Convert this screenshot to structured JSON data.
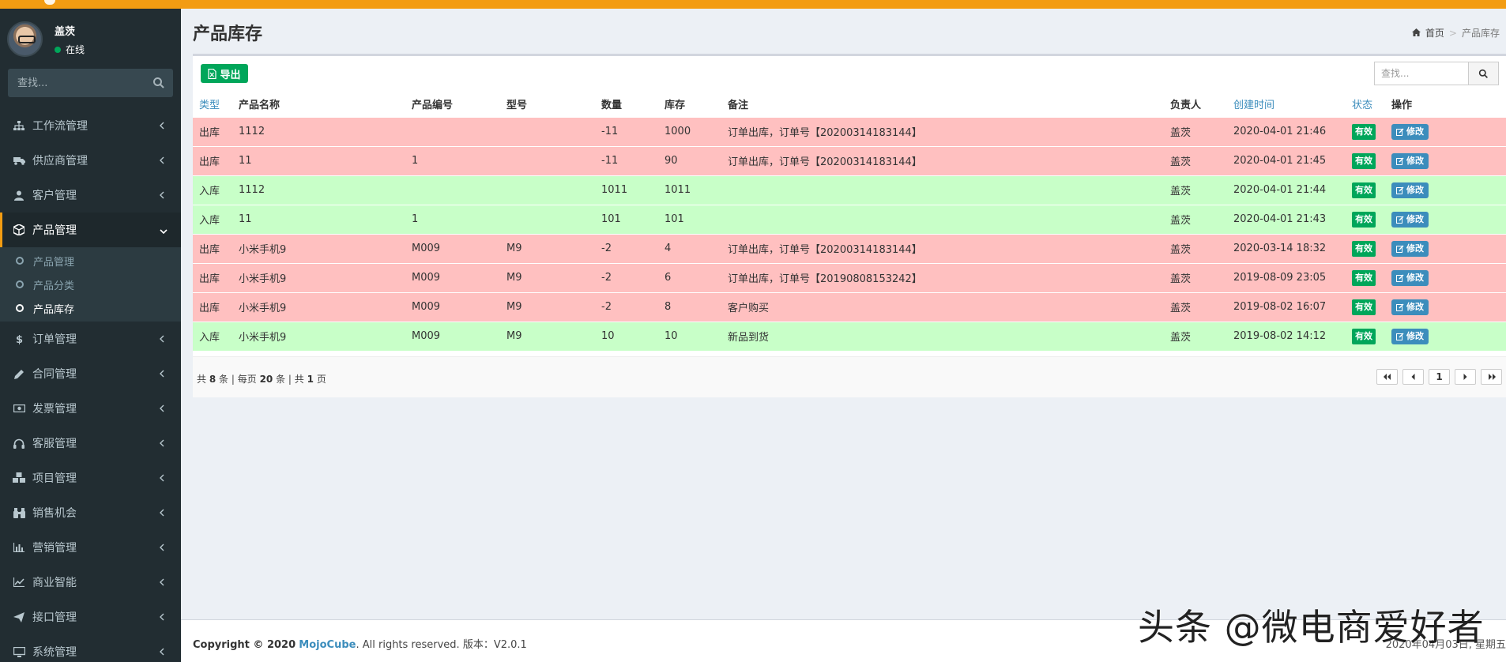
{
  "user": {
    "name": "盖茨",
    "status": "在线"
  },
  "sidebar": {
    "search_placeholder": "查找...",
    "menu": [
      {
        "label": "工作流管理",
        "icon": "sitemap-icon"
      },
      {
        "label": "供应商管理",
        "icon": "truck-icon"
      },
      {
        "label": "客户管理",
        "icon": "user-icon"
      },
      {
        "label": "产品管理",
        "icon": "cube-icon",
        "active": true
      },
      {
        "label": "订单管理",
        "icon": "dollar-icon"
      },
      {
        "label": "合同管理",
        "icon": "pencil-icon"
      },
      {
        "label": "发票管理",
        "icon": "money-icon"
      },
      {
        "label": "客服管理",
        "icon": "headphones-icon"
      },
      {
        "label": "项目管理",
        "icon": "cubes-icon"
      },
      {
        "label": "销售机会",
        "icon": "binoculars-icon"
      },
      {
        "label": "营销管理",
        "icon": "bar-chart-icon"
      },
      {
        "label": "商业智能",
        "icon": "line-chart-icon"
      },
      {
        "label": "接口管理",
        "icon": "paper-plane-icon"
      },
      {
        "label": "系统管理",
        "icon": "desktop-icon"
      }
    ],
    "submenu": [
      "产品管理",
      "产品分类",
      "产品库存"
    ]
  },
  "page": {
    "title": "产品库存",
    "breadcrumb": [
      "首页",
      "产品库存"
    ]
  },
  "toolbar": {
    "export_label": "导出",
    "search_placeholder": "查找..."
  },
  "table": {
    "headers": [
      "类型",
      "产品名称",
      "产品编号",
      "型号",
      "数量",
      "库存",
      "备注",
      "负责人",
      "创建时间",
      "状态",
      "操作"
    ],
    "rows": [
      {
        "kind": "out",
        "cells": [
          "出库",
          "1112",
          "",
          "",
          "-11",
          "1000",
          "订单出库，订单号【20200314183144】",
          "盖茨",
          "2020-04-01 21:46"
        ]
      },
      {
        "kind": "out",
        "cells": [
          "出库",
          "11",
          "1",
          "",
          "-11",
          "90",
          "订单出库，订单号【20200314183144】",
          "盖茨",
          "2020-04-01 21:45"
        ]
      },
      {
        "kind": "in",
        "cells": [
          "入库",
          "1112",
          "",
          "",
          "1011",
          "1011",
          "",
          "盖茨",
          "2020-04-01 21:44"
        ]
      },
      {
        "kind": "in",
        "cells": [
          "入库",
          "11",
          "1",
          "",
          "101",
          "101",
          "",
          "盖茨",
          "2020-04-01 21:43"
        ]
      },
      {
        "kind": "out",
        "cells": [
          "出库",
          "小米手机9",
          "M009",
          "M9",
          "-2",
          "4",
          "订单出库，订单号【20200314183144】",
          "盖茨",
          "2020-03-14 18:32"
        ]
      },
      {
        "kind": "out",
        "cells": [
          "出库",
          "小米手机9",
          "M009",
          "M9",
          "-2",
          "6",
          "订单出库，订单号【20190808153242】",
          "盖茨",
          "2019-08-09 23:05"
        ]
      },
      {
        "kind": "out",
        "cells": [
          "出库",
          "小米手机9",
          "M009",
          "M9",
          "-2",
          "8",
          "客户购买",
          "盖茨",
          "2019-08-02 16:07"
        ]
      },
      {
        "kind": "in",
        "cells": [
          "入库",
          "小米手机9",
          "M009",
          "M9",
          "10",
          "10",
          "新品到货",
          "盖茨",
          "2019-08-02 14:12"
        ]
      }
    ],
    "status_label": "有效",
    "edit_label": "修改"
  },
  "pagination": {
    "total_prefix": "共",
    "total": "8",
    "total_unit": "条",
    "per_page_prefix": "每页",
    "per_page": "20",
    "per_page_unit": "条",
    "pages_prefix": "共",
    "pages": "1",
    "pages_unit": "页",
    "current": "1"
  },
  "footer": {
    "copyright": "Copyright © 2020",
    "brand": "MojoCube",
    "rights": ". All rights reserved. 版本：V2.0.1",
    "date": "2020年04月03日, 星期五"
  },
  "watermark": "头条 @微电商爱好者",
  "colors": {
    "accent": "#f39c12",
    "sidebar": "#222d32",
    "out_row": "#ffc0c0",
    "in_row": "#c8ffc8",
    "success": "#00a65a",
    "link": "#3c8dbc"
  }
}
